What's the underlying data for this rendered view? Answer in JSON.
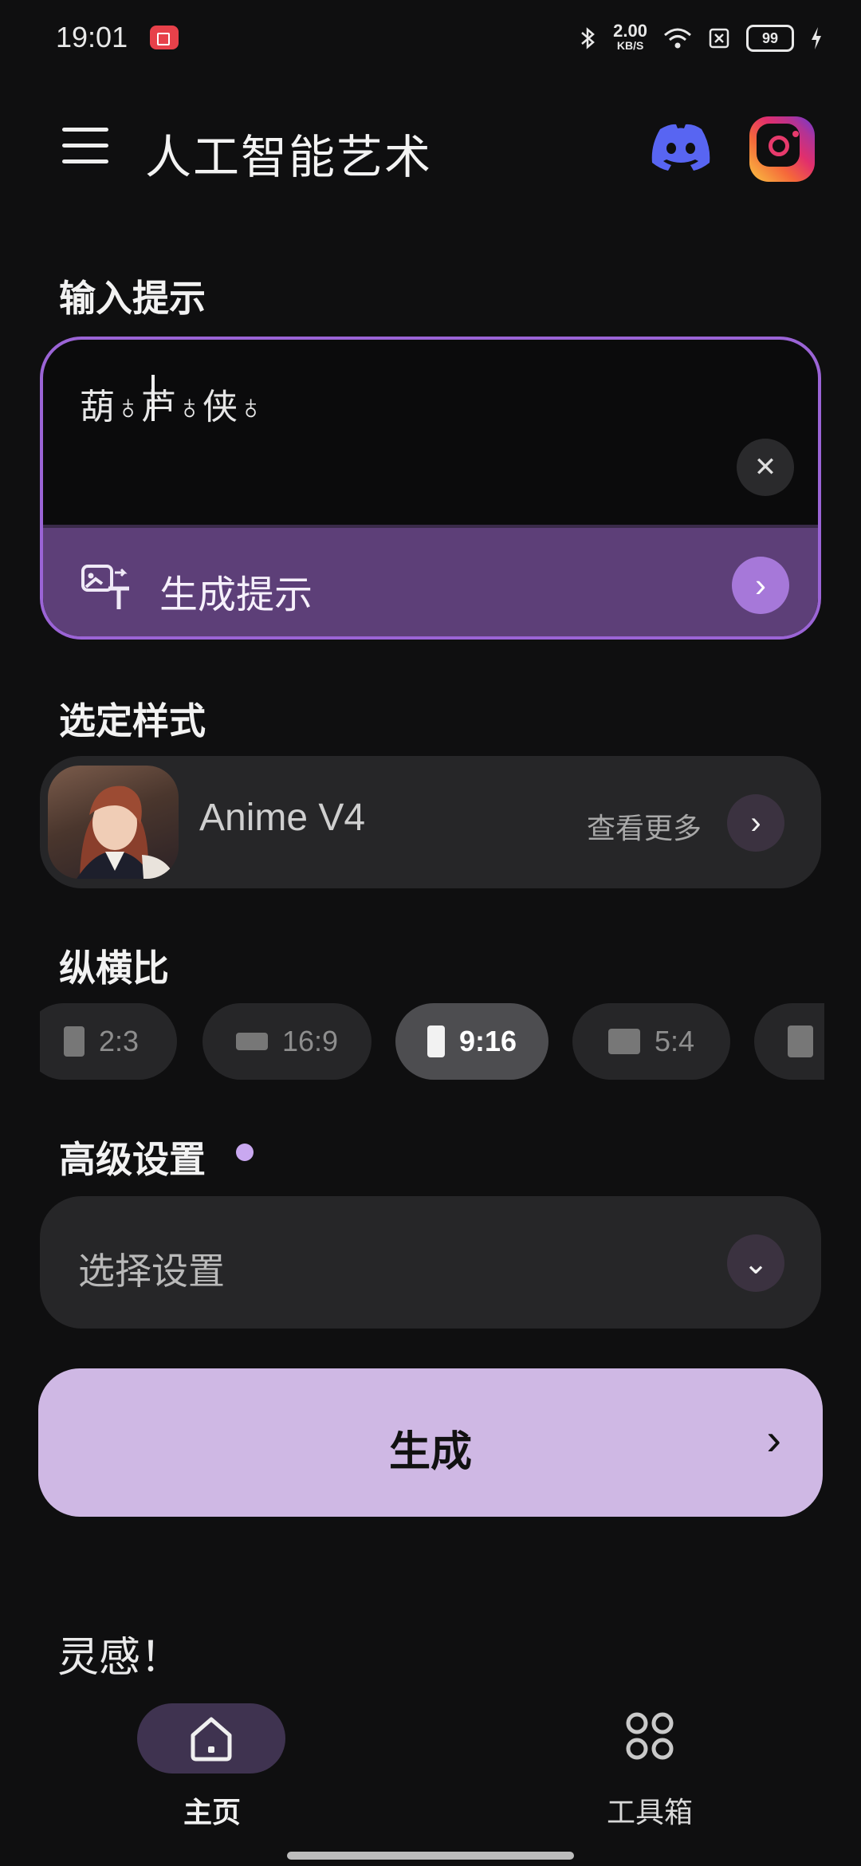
{
  "status_bar": {
    "time": "19:01",
    "speed_value": "2.00",
    "speed_unit": "KB/S",
    "battery": "99",
    "icons": [
      "screen-record-icon",
      "bluetooth-icon",
      "wifi-icon",
      "no-sim-icon",
      "battery-icon",
      "charging-icon"
    ]
  },
  "app_bar": {
    "title": "人工智能艺术",
    "icons": [
      "menu-icon",
      "discord-icon",
      "instagram-icon"
    ]
  },
  "prompt": {
    "section_label": "输入提示",
    "value": "葫♁芦♁侠♁",
    "generate_prompt_label": "生成提示"
  },
  "style": {
    "section_label": "选定样式",
    "name": "Anime V4",
    "see_more": "查看更多"
  },
  "aspect_ratio": {
    "section_label": "纵横比",
    "options": [
      "2:3",
      "16:9",
      "9:16",
      "5:4"
    ],
    "selected": "9:16"
  },
  "advanced": {
    "section_label": "高级设置",
    "placeholder": "选择设置"
  },
  "generate": {
    "label": "生成"
  },
  "inspiration": {
    "label": "灵感！"
  },
  "bottom_nav": {
    "items": [
      {
        "label": "主页",
        "active": true
      },
      {
        "label": "工具箱",
        "active": false
      }
    ]
  },
  "colors": {
    "background": "#0f0f10",
    "accent_border": "#9b64d6",
    "prompt_bar": "#5d3f78",
    "generate_button": "#cfb8e4"
  }
}
